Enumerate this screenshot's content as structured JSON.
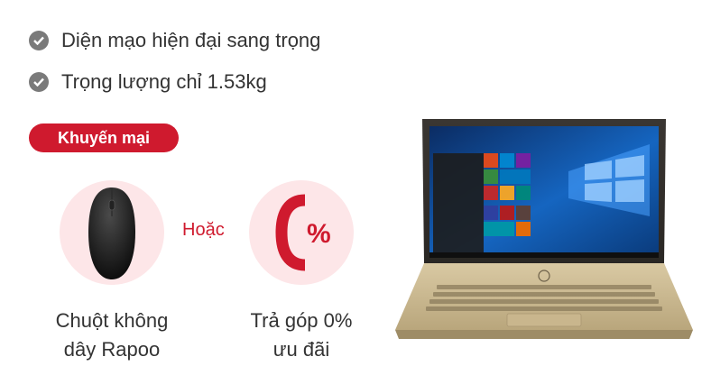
{
  "features": [
    {
      "text": "Diện mạo hiện đại sang trọng",
      "icon": "check-circle-icon"
    },
    {
      "text": "Trọng lượng chỉ 1.53kg",
      "icon": "check-circle-icon"
    }
  ],
  "promo": {
    "badge": "Khuyến mại",
    "or_text": "Hoặc",
    "gift_1": {
      "line1": "Chuột không",
      "line2": "dây Rapoo"
    },
    "gift_2": {
      "line1": "Trả góp 0%",
      "line2": "ưu đãi",
      "percent_sign": "%"
    }
  },
  "colors": {
    "accent": "#cf1a2e",
    "accent_light": "#fde6e8",
    "check": "#7a7a7a"
  }
}
